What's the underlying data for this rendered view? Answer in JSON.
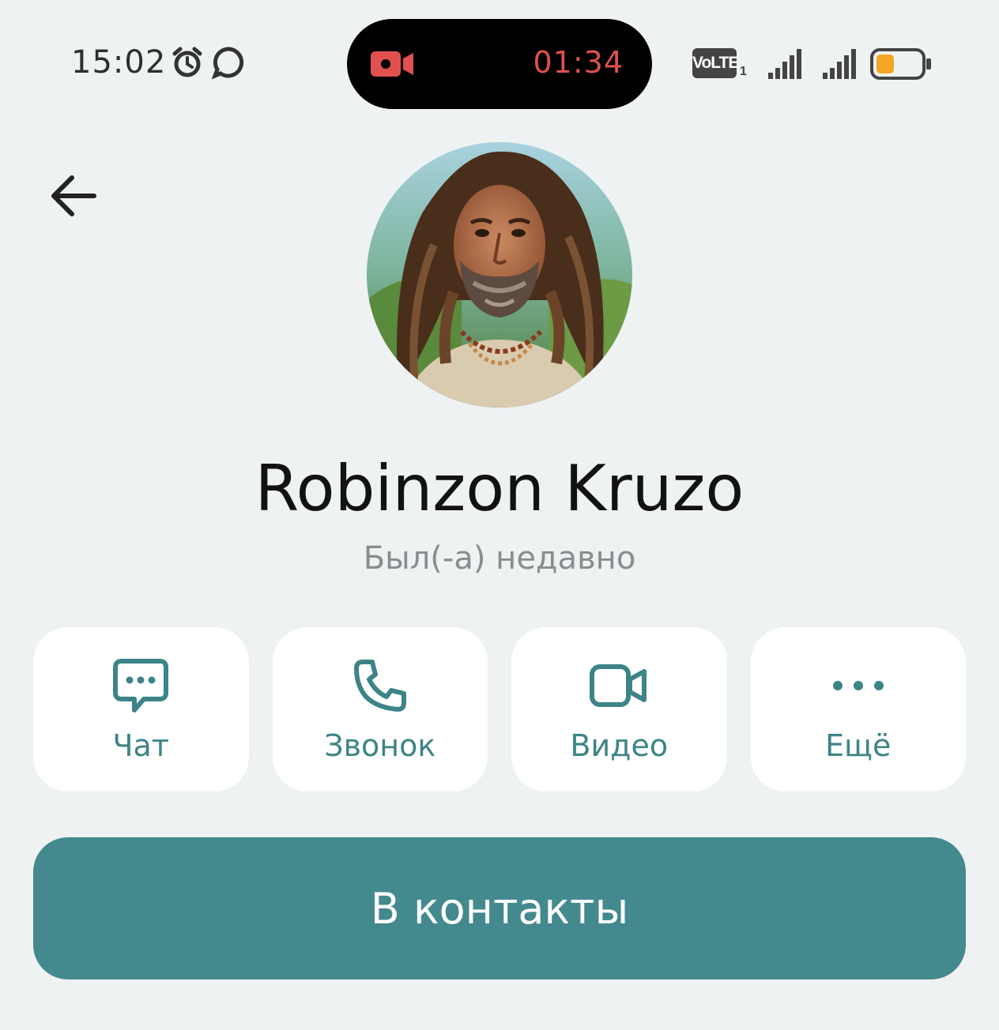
{
  "status_bar": {
    "time": "15:02",
    "icons": [
      "alarm-icon",
      "chat-bubble-icon"
    ],
    "recording": {
      "icon": "video-camera-icon",
      "timer": "01:34",
      "color": "#e0504f"
    },
    "volte": "VoLTE",
    "volte_sub": "1",
    "battery_color": "#f5a623"
  },
  "header": {
    "back_icon": "arrow-left-icon"
  },
  "profile": {
    "name": "Robinzon Kruzo",
    "presence": "Был(-а) недавно"
  },
  "actions": [
    {
      "label": "Чат",
      "icon": "chat-bubble-icon"
    },
    {
      "label": "Звонок",
      "icon": "phone-icon"
    },
    {
      "label": "Видео",
      "icon": "video-camera-icon"
    },
    {
      "label": "Ещё",
      "icon": "more-dots-icon"
    }
  ],
  "primary_button": {
    "label": "В контакты"
  },
  "colors": {
    "accent": "#43898d",
    "accent_text": "#3d8487",
    "background": "#eef2f3"
  }
}
